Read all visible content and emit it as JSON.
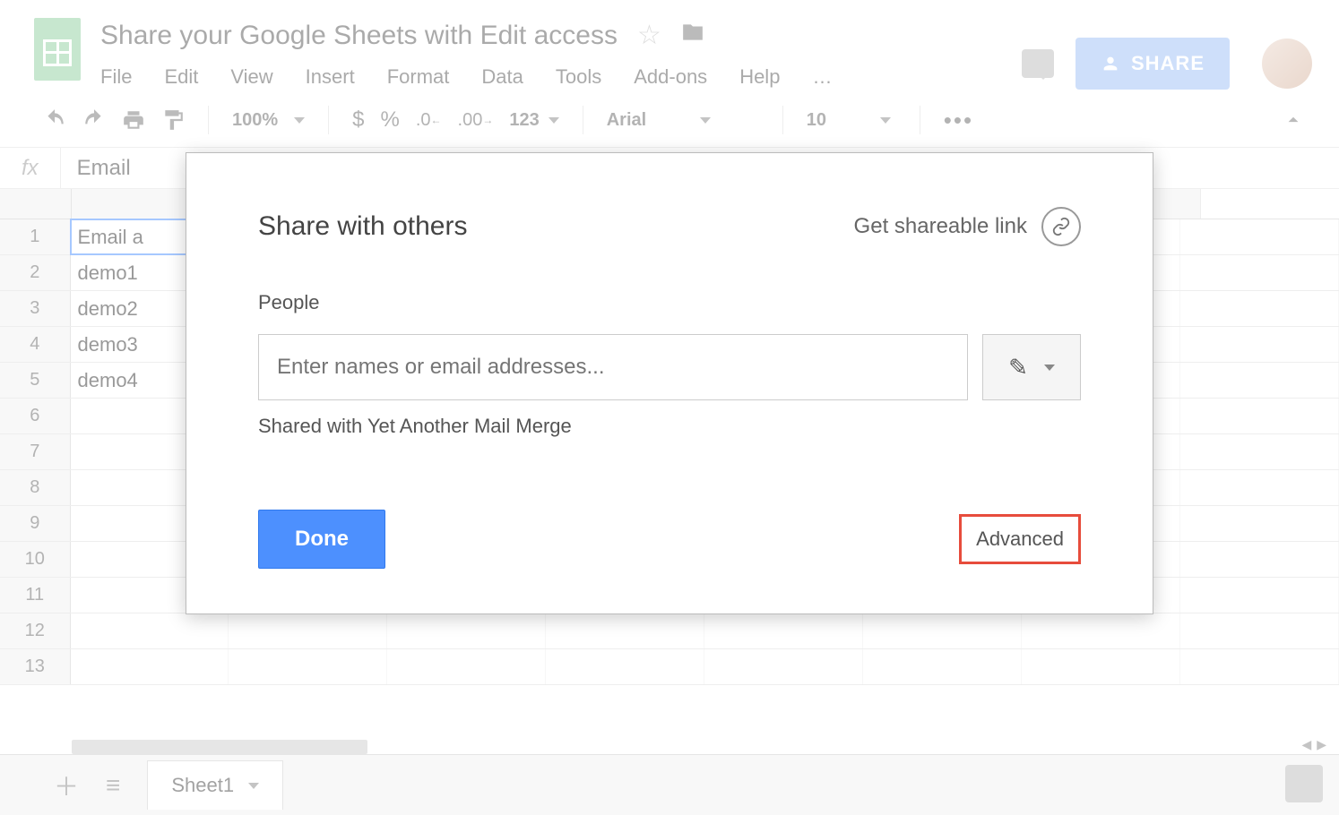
{
  "header": {
    "doc_title": "Share your Google Sheets with Edit access",
    "menu": [
      "File",
      "Edit",
      "View",
      "Insert",
      "Format",
      "Data",
      "Tools",
      "Add-ons",
      "Help",
      "…"
    ],
    "share_button": "SHARE"
  },
  "toolbar": {
    "zoom": "100%",
    "currency": "$",
    "percent": "%",
    "dec_dec": ".0",
    "inc_dec": ".00",
    "num_format": "123",
    "font": "Arial",
    "font_size": "10",
    "more": "•••"
  },
  "formula_bar": {
    "fx": "fx",
    "content": "Email"
  },
  "grid": {
    "col_letters": [
      "",
      "",
      "",
      "",
      "",
      "",
      ""
    ],
    "rows": [
      {
        "n": "1",
        "a": "Email a"
      },
      {
        "n": "2",
        "a": "demo1"
      },
      {
        "n": "3",
        "a": "demo2"
      },
      {
        "n": "4",
        "a": "demo3"
      },
      {
        "n": "5",
        "a": "demo4"
      },
      {
        "n": "6",
        "a": ""
      },
      {
        "n": "7",
        "a": ""
      },
      {
        "n": "8",
        "a": ""
      },
      {
        "n": "9",
        "a": ""
      },
      {
        "n": "10",
        "a": ""
      },
      {
        "n": "11",
        "a": ""
      },
      {
        "n": "12",
        "a": ""
      },
      {
        "n": "13",
        "a": ""
      }
    ],
    "selected_row": 0
  },
  "sheet_tabs": {
    "add": "＋",
    "list": "≡",
    "tab1": "Sheet1"
  },
  "share_dialog": {
    "title": "Share with others",
    "get_link": "Get shareable link",
    "people_label": "People",
    "input_placeholder": "Enter names or email addresses...",
    "shared_with": "Shared with Yet Another Mail Merge",
    "done": "Done",
    "advanced": "Advanced"
  }
}
